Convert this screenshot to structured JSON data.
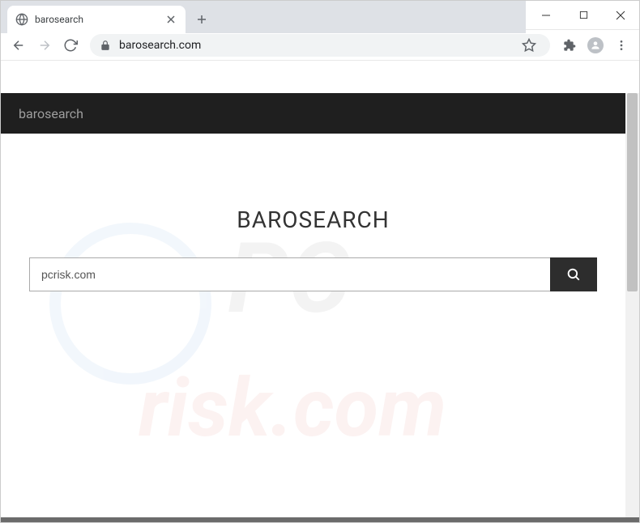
{
  "window": {
    "tab_title": "barosearch"
  },
  "address_bar": {
    "url": "barosearch.com"
  },
  "page": {
    "header_title": "barosearch",
    "main_title": "BAROSEARCH",
    "search_value": "pcrisk.com"
  },
  "watermark": {
    "line1": "PC",
    "line2": "risk.com"
  }
}
